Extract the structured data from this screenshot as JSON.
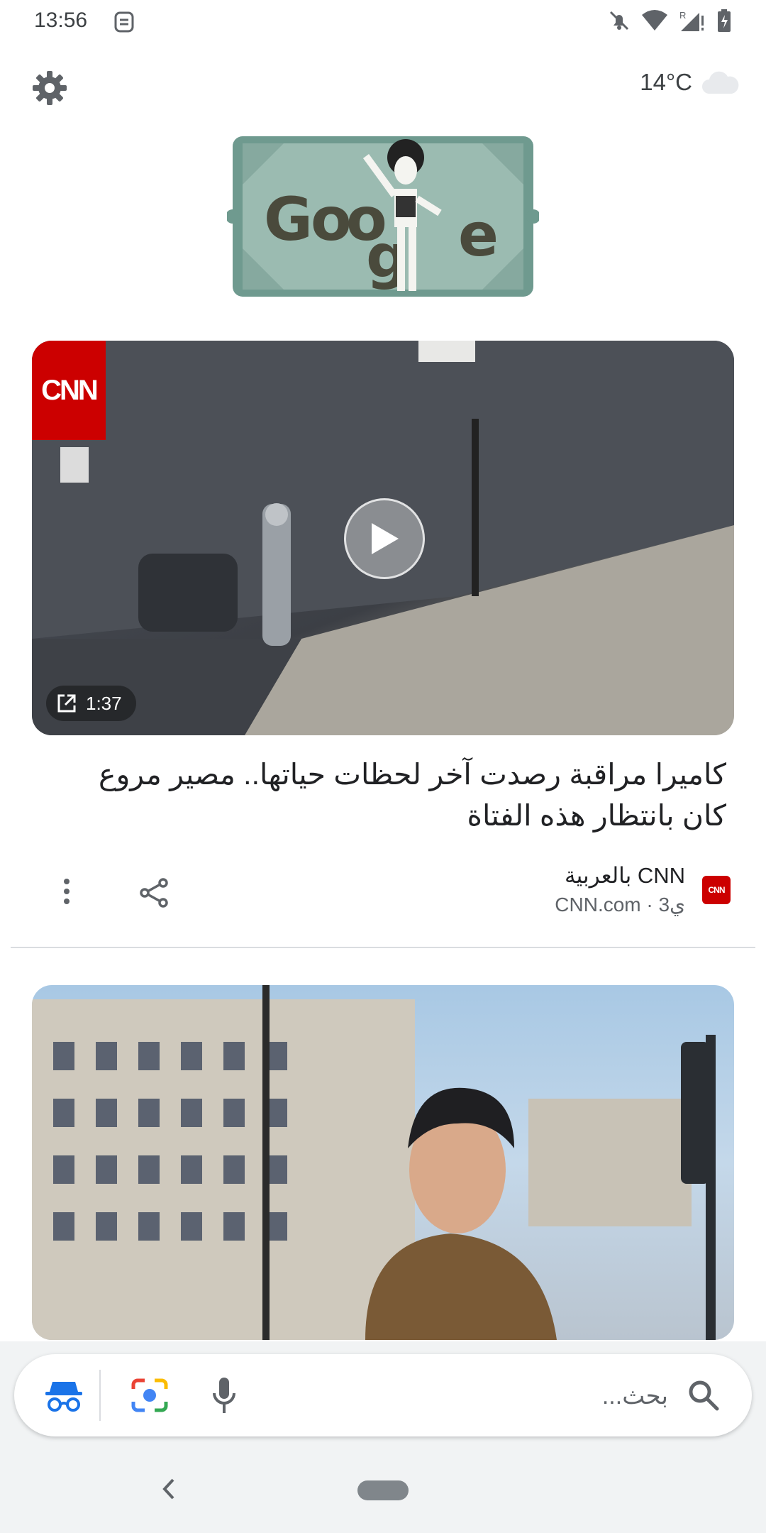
{
  "status_bar": {
    "time": "13:56",
    "icons": [
      "assistant-icon",
      "silent-icon",
      "wifi-icon",
      "signal-roaming-icon",
      "battery-charging-icon"
    ],
    "roaming_label": "R"
  },
  "header": {
    "settings_icon": "gear-icon",
    "weather_temp": "14°C",
    "weather_icon": "cloud-icon"
  },
  "doodle": {
    "letters": [
      "G",
      "o",
      "o",
      "g",
      "e"
    ]
  },
  "feed": {
    "card1": {
      "source_logo_text": "CNN",
      "duration": "1:37",
      "title": "كاميرا مراقبة رصدت آخر لحظات حياتها.. مصير مروع كان بانتظار هذه الفتاة",
      "source_name": "CNN بالعربية",
      "source_meta": "CNN.com · 3ي",
      "source_badge": "CNN"
    }
  },
  "search": {
    "placeholder": "بحث..."
  },
  "colors": {
    "cnn_red": "#cc0000",
    "google_blue": "#1a73e8",
    "doodle_frame": "#6f9a8f",
    "doodle_panel": "#9bbbb1"
  }
}
